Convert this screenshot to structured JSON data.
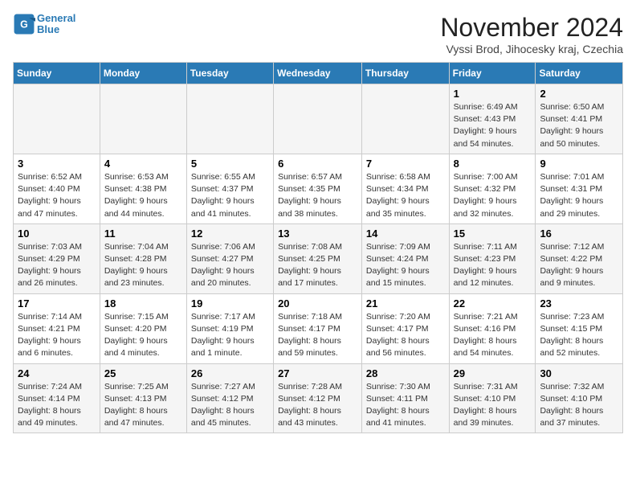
{
  "header": {
    "logo_line1": "General",
    "logo_line2": "Blue",
    "month_year": "November 2024",
    "location": "Vyssi Brod, Jihocesky kraj, Czechia"
  },
  "columns": [
    "Sunday",
    "Monday",
    "Tuesday",
    "Wednesday",
    "Thursday",
    "Friday",
    "Saturday"
  ],
  "weeks": [
    [
      {
        "day": "",
        "info": ""
      },
      {
        "day": "",
        "info": ""
      },
      {
        "day": "",
        "info": ""
      },
      {
        "day": "",
        "info": ""
      },
      {
        "day": "",
        "info": ""
      },
      {
        "day": "1",
        "info": "Sunrise: 6:49 AM\nSunset: 4:43 PM\nDaylight: 9 hours and 54 minutes."
      },
      {
        "day": "2",
        "info": "Sunrise: 6:50 AM\nSunset: 4:41 PM\nDaylight: 9 hours and 50 minutes."
      }
    ],
    [
      {
        "day": "3",
        "info": "Sunrise: 6:52 AM\nSunset: 4:40 PM\nDaylight: 9 hours and 47 minutes."
      },
      {
        "day": "4",
        "info": "Sunrise: 6:53 AM\nSunset: 4:38 PM\nDaylight: 9 hours and 44 minutes."
      },
      {
        "day": "5",
        "info": "Sunrise: 6:55 AM\nSunset: 4:37 PM\nDaylight: 9 hours and 41 minutes."
      },
      {
        "day": "6",
        "info": "Sunrise: 6:57 AM\nSunset: 4:35 PM\nDaylight: 9 hours and 38 minutes."
      },
      {
        "day": "7",
        "info": "Sunrise: 6:58 AM\nSunset: 4:34 PM\nDaylight: 9 hours and 35 minutes."
      },
      {
        "day": "8",
        "info": "Sunrise: 7:00 AM\nSunset: 4:32 PM\nDaylight: 9 hours and 32 minutes."
      },
      {
        "day": "9",
        "info": "Sunrise: 7:01 AM\nSunset: 4:31 PM\nDaylight: 9 hours and 29 minutes."
      }
    ],
    [
      {
        "day": "10",
        "info": "Sunrise: 7:03 AM\nSunset: 4:29 PM\nDaylight: 9 hours and 26 minutes."
      },
      {
        "day": "11",
        "info": "Sunrise: 7:04 AM\nSunset: 4:28 PM\nDaylight: 9 hours and 23 minutes."
      },
      {
        "day": "12",
        "info": "Sunrise: 7:06 AM\nSunset: 4:27 PM\nDaylight: 9 hours and 20 minutes."
      },
      {
        "day": "13",
        "info": "Sunrise: 7:08 AM\nSunset: 4:25 PM\nDaylight: 9 hours and 17 minutes."
      },
      {
        "day": "14",
        "info": "Sunrise: 7:09 AM\nSunset: 4:24 PM\nDaylight: 9 hours and 15 minutes."
      },
      {
        "day": "15",
        "info": "Sunrise: 7:11 AM\nSunset: 4:23 PM\nDaylight: 9 hours and 12 minutes."
      },
      {
        "day": "16",
        "info": "Sunrise: 7:12 AM\nSunset: 4:22 PM\nDaylight: 9 hours and 9 minutes."
      }
    ],
    [
      {
        "day": "17",
        "info": "Sunrise: 7:14 AM\nSunset: 4:21 PM\nDaylight: 9 hours and 6 minutes."
      },
      {
        "day": "18",
        "info": "Sunrise: 7:15 AM\nSunset: 4:20 PM\nDaylight: 9 hours and 4 minutes."
      },
      {
        "day": "19",
        "info": "Sunrise: 7:17 AM\nSunset: 4:19 PM\nDaylight: 9 hours and 1 minute."
      },
      {
        "day": "20",
        "info": "Sunrise: 7:18 AM\nSunset: 4:17 PM\nDaylight: 8 hours and 59 minutes."
      },
      {
        "day": "21",
        "info": "Sunrise: 7:20 AM\nSunset: 4:17 PM\nDaylight: 8 hours and 56 minutes."
      },
      {
        "day": "22",
        "info": "Sunrise: 7:21 AM\nSunset: 4:16 PM\nDaylight: 8 hours and 54 minutes."
      },
      {
        "day": "23",
        "info": "Sunrise: 7:23 AM\nSunset: 4:15 PM\nDaylight: 8 hours and 52 minutes."
      }
    ],
    [
      {
        "day": "24",
        "info": "Sunrise: 7:24 AM\nSunset: 4:14 PM\nDaylight: 8 hours and 49 minutes."
      },
      {
        "day": "25",
        "info": "Sunrise: 7:25 AM\nSunset: 4:13 PM\nDaylight: 8 hours and 47 minutes."
      },
      {
        "day": "26",
        "info": "Sunrise: 7:27 AM\nSunset: 4:12 PM\nDaylight: 8 hours and 45 minutes."
      },
      {
        "day": "27",
        "info": "Sunrise: 7:28 AM\nSunset: 4:12 PM\nDaylight: 8 hours and 43 minutes."
      },
      {
        "day": "28",
        "info": "Sunrise: 7:30 AM\nSunset: 4:11 PM\nDaylight: 8 hours and 41 minutes."
      },
      {
        "day": "29",
        "info": "Sunrise: 7:31 AM\nSunset: 4:10 PM\nDaylight: 8 hours and 39 minutes."
      },
      {
        "day": "30",
        "info": "Sunrise: 7:32 AM\nSunset: 4:10 PM\nDaylight: 8 hours and 37 minutes."
      }
    ]
  ]
}
